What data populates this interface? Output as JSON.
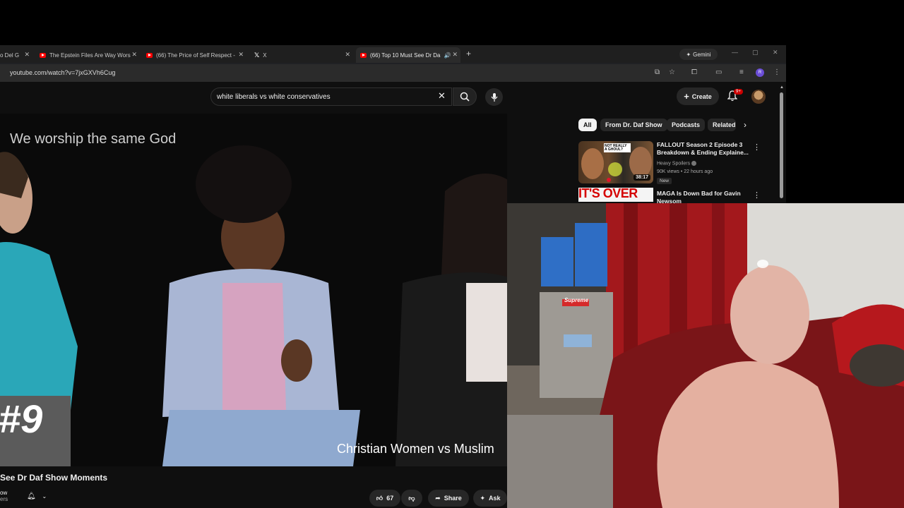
{
  "browser": {
    "tabs": [
      {
        "title": "o Del G",
        "icon": "youtube-icon"
      },
      {
        "title": "The Epstein Files Are Way Wors",
        "icon": "youtube-icon"
      },
      {
        "title": "(66) The Price of Self Respect -",
        "icon": "youtube-icon"
      },
      {
        "title": "X",
        "icon": "x-logo-icon"
      },
      {
        "title": "(66) Top 10 Must See Dr Da",
        "icon": "youtube-icon",
        "active": true
      }
    ],
    "gemini_label": "Gemini",
    "url": "youtube.com/watch?v=7jxGXVh6Cug",
    "profile_initial": "R"
  },
  "youtube": {
    "search": {
      "value": "white liberals vs white conservatives"
    },
    "create_label": "Create",
    "notification_count": "9+",
    "video": {
      "caption_top": "We worship the same God",
      "caption_bottom": "Christian Women vs Muslim",
      "rank_overlay": "#9",
      "title": "See Dr Daf Show Moments",
      "channel_fragment": "ow",
      "subscribers_fragment": "ers"
    },
    "actions": {
      "likes": "67",
      "share_label": "Share",
      "ask_label": "Ask"
    },
    "chips": [
      "All",
      "From Dr. Daf Show",
      "Podcasts",
      "Related"
    ],
    "recommendations": [
      {
        "title": "FALLOUT Season 2 Episode 3 Breakdown & Ending Explaine...",
        "channel": "Heavy Spoilers",
        "meta": "90K views • 22 hours ago",
        "tag": "New",
        "duration": "38:17",
        "thumb_text": "NOT REALLY A GHOUL?"
      },
      {
        "title": "MAGA Is Down Bad for Gavin Newsom",
        "thumb_text": "IT'S OVER"
      }
    ]
  },
  "webcam": {
    "label_supreme": "Supreme"
  }
}
